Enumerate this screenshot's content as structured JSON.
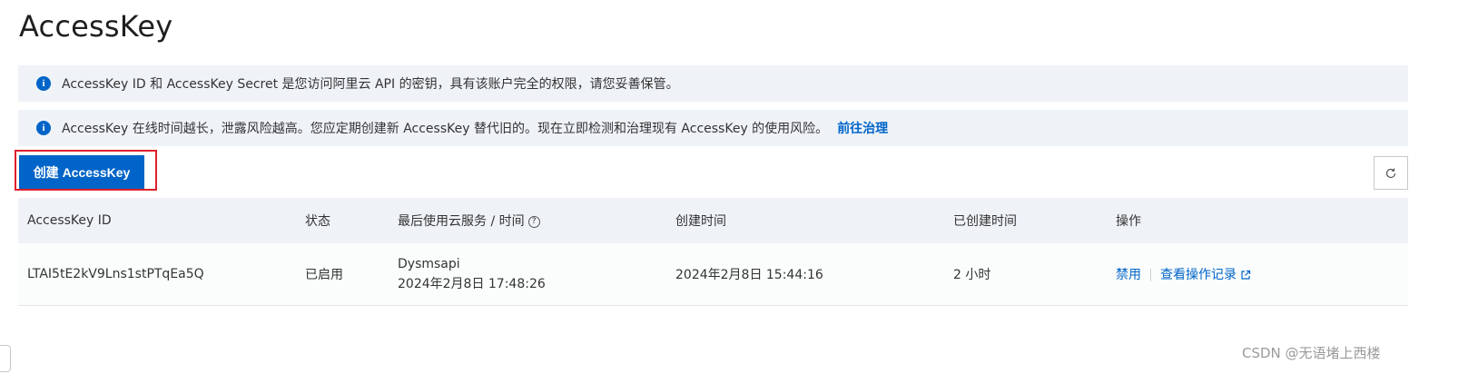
{
  "page": {
    "title": "AccessKey"
  },
  "alerts": [
    {
      "text": "AccessKey ID 和 AccessKey Secret 是您访问阿里云 API 的密钥，具有该账户完全的权限，请您妥善保管。",
      "link": ""
    },
    {
      "text": "AccessKey 在线时间越长，泄露风险越高。您应定期创建新 AccessKey 替代旧的。现在立即检测和治理现有 AccessKey 的使用风险。",
      "link": "前往治理"
    }
  ],
  "toolbar": {
    "create_label": "创建 AccessKey",
    "refresh_icon": "refresh-icon"
  },
  "table": {
    "columns": [
      "AccessKey ID",
      "状态",
      "最后使用云服务 / 时间",
      "创建时间",
      "已创建时间",
      "操作"
    ],
    "rows": [
      {
        "id": "LTAI5tE2kV9Lns1stPTqEa5Q",
        "status": "已启用",
        "last_service": "Dysmsapi",
        "last_time": "2024年2月8日 17:48:26",
        "created": "2024年2月8日 15:44:16",
        "age": "2 小时",
        "actions": [
          "禁用",
          "查看操作记录"
        ]
      }
    ]
  },
  "watermark": "CSDN @无语堵上西楼",
  "colors": {
    "accent": "#0064c8",
    "alert_bg": "#eff3f8",
    "highlight": "#e0202b"
  }
}
